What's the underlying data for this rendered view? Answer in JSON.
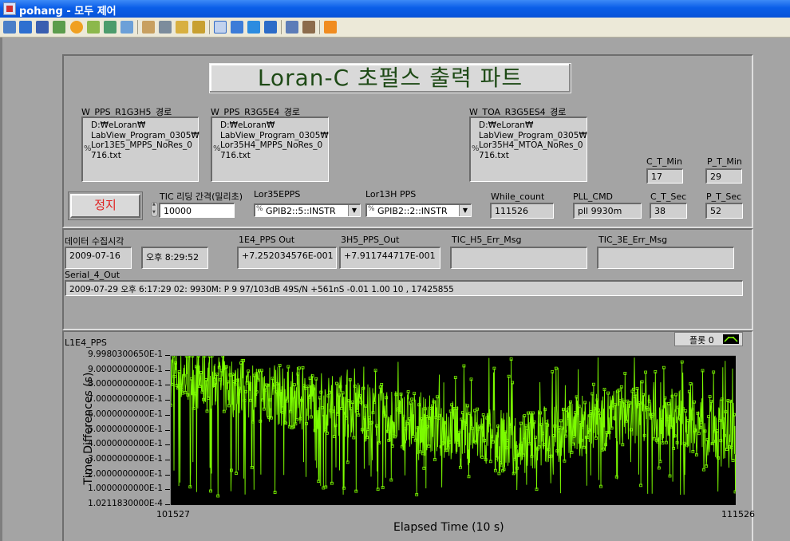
{
  "window": {
    "title": "pohang - 모두 제어"
  },
  "toolbar": {
    "icons": [
      "window-icon",
      "panel-icon",
      "terminal-icon",
      "tools-icon",
      "info-icon",
      "connect-icon",
      "phone-icon",
      "comment-icon",
      "user-up-icon",
      "network-icon",
      "lock-icon",
      "lock2-icon",
      "frame-icon",
      "fit-icon",
      "monitor-icon",
      "monitor2-icon",
      "grid-icon",
      "wrench-icon",
      "exit-icon"
    ]
  },
  "panel": {
    "title": "Loran-C 초펄스 출력 파트",
    "paths": [
      {
        "label": "W_PPS_R1G3H5_경로",
        "lines": [
          "D:₩eLoran₩",
          "LabView_Program_0305₩",
          "Lor13E5_MPPS_NoRes_0",
          "716.txt"
        ]
      },
      {
        "label": "W_PPS_R3G5E4_경로",
        "lines": [
          "D:₩eLoran₩",
          "LabView_Program_0305₩",
          "Lor35H4_MPPS_NoRes_0",
          "716.txt"
        ]
      },
      {
        "label": "W_TOA_R3G5ES4_경로",
        "lines": [
          "D:₩eLoran₩",
          "LabView_Program_0305₩",
          "Lor35H4_MTOA_NoRes_0",
          "716.txt"
        ]
      }
    ],
    "c_t_min": {
      "label": "C_T_Min",
      "value": "17"
    },
    "p_t_min": {
      "label": "P_T_Min",
      "value": "29"
    },
    "stop_button": "정지",
    "tic_interval": {
      "label": "TIC 리딩 간격(밀리초)",
      "value": "10000"
    },
    "lor35": {
      "label": "Lor35EPPS",
      "value": "GPIB2::5::INSTR"
    },
    "lor13": {
      "label": "Lor13H PPS",
      "value": "GPIB2::2::INSTR"
    },
    "while_count": {
      "label": "While_count",
      "value": "111526"
    },
    "pll_cmd": {
      "label": "PLL_CMD",
      "value": "pll 9930m"
    },
    "c_t_sec": {
      "label": "C_T_Sec",
      "value": "38"
    },
    "p_t_sec": {
      "label": "P_T_Sec",
      "value": "52"
    }
  },
  "data_panel": {
    "acq_time_label": "데이터 수집시각",
    "date": "2009-07-16",
    "time": "오후 8:29:52",
    "e4_pps": {
      "label": "1E4_PPS Out",
      "value": "+7.252034576E-001"
    },
    "h5_pps": {
      "label": "3H5_PPS_Out",
      "value": "+7.911744717E-001"
    },
    "tic_h5": {
      "label": "TIC_H5_Err_Msg",
      "value": ""
    },
    "tic_3e": {
      "label": "TIC_3E_Err_Msg",
      "value": ""
    },
    "serial": {
      "label": "Serial_4_Out",
      "value": "2009-07-29 오후 6:17:29 02: 9930M: P 9  97/103dB  49S/N  +561nS -0.01 1.00   10 , 17425855"
    }
  },
  "chart": {
    "label": "L1E4_PPS",
    "legend": "플롯 0",
    "series_color": "#7cfc00",
    "ylabel": "Time Differences (s)",
    "xlabel": "Elapsed Time (10 s)",
    "yticks": [
      "9.9980300650E-1",
      "9.0000000000E-1",
      "8.0000000000E-1",
      "7.0000000000E-1",
      "6.0000000000E-1",
      "5.0000000000E-1",
      "4.0000000000E-1",
      "3.0000000000E-1",
      "2.0000000000E-1",
      "1.0000000000E-1",
      "1.0211830000E-4"
    ],
    "xticks": [
      "101527",
      "111526"
    ]
  },
  "chart_data": {
    "type": "line",
    "title": "L1E4_PPS",
    "xlabel": "Elapsed Time (10 s)",
    "ylabel": "Time Differences (s)",
    "xlim": [
      101527,
      111526
    ],
    "ylim": [
      0.0001021183,
      0.9998030065
    ],
    "series": [
      {
        "name": "플롯 0",
        "x": [
          101527,
          102027,
          102527,
          103027,
          103527,
          104027,
          104527,
          105027,
          105527,
          106027,
          106527,
          107027,
          107527,
          108027,
          108527,
          109027,
          109527,
          110027,
          110527,
          111026,
          111526
        ],
        "values": [
          0.88,
          0.84,
          0.8,
          0.76,
          0.73,
          0.7,
          0.66,
          0.62,
          0.58,
          0.54,
          0.5,
          0.46,
          0.42,
          0.45,
          0.5,
          0.55,
          0.6,
          0.63,
          0.58,
          0.52,
          0.5
        ]
      }
    ],
    "grid": false
  }
}
